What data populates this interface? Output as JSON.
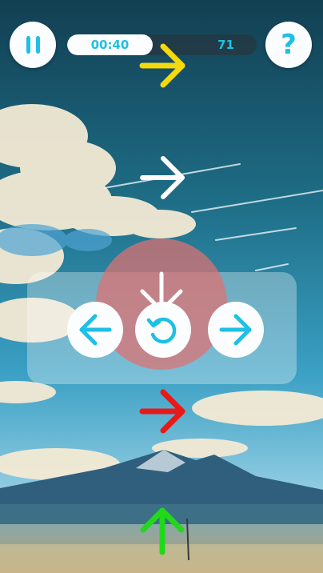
{
  "hud": {
    "pause_icon": "pause-icon",
    "help_label": "?",
    "timer": "00:40",
    "score": "71",
    "progress_fraction": 0.45
  },
  "lanes": [
    {
      "direction": "right",
      "color": "#f4d90e"
    },
    {
      "direction": "right",
      "color": "#ffffff"
    },
    {
      "direction": "right",
      "color": "#e81919"
    },
    {
      "direction": "up",
      "color": "#21d91a"
    }
  ],
  "controls": {
    "left_icon": "arrow-left-icon",
    "rotate_icon": "rotate-icon",
    "right_icon": "arrow-right-icon",
    "drop_indicator_icon": "arrow-down-icon"
  },
  "colors": {
    "accent": "#1fbfe6",
    "hit_zone": "#e07070",
    "button_bg": "#fbfdfe"
  }
}
